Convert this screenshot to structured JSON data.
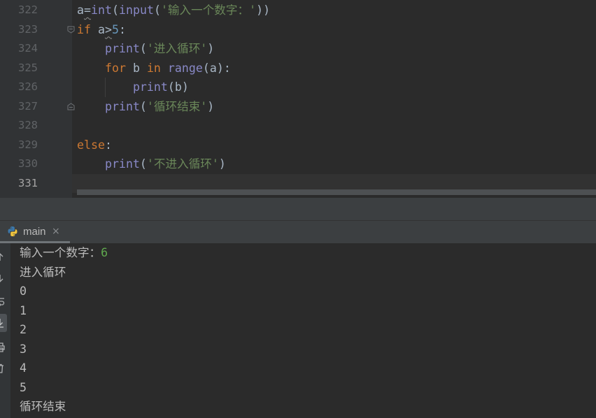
{
  "theme": {
    "editor_bg": "#2b2b2b",
    "gutter_bg": "#313335",
    "current_line_bg": "#323232",
    "line_number": "#606366",
    "current_line_number": "#a4a3a3",
    "code_text": "#a9b7c6",
    "panel_bg": "#3c3f41",
    "console_text": "#bbbbbb",
    "user_input": "#5fa84e"
  },
  "editor": {
    "lines": [
      {
        "number": "322",
        "tokens": [
          {
            "text": "a"
          },
          {
            "text": "=",
            "warn": true
          },
          {
            "text": "int",
            "color": "#8888c6"
          },
          {
            "text": "("
          },
          {
            "text": "input",
            "color": "#8888c6"
          },
          {
            "text": "("
          },
          {
            "text": "'输入一个数字：'",
            "color": "#6a8759"
          },
          {
            "text": "))"
          }
        ]
      },
      {
        "number": "323",
        "fold": "fold-start-icon",
        "tokens": [
          {
            "text": "if",
            "color": "#cc7832"
          },
          {
            "text": " a"
          },
          {
            "text": ">",
            "warn": true
          },
          {
            "text": "5",
            "color": "#6897bb"
          },
          {
            "text": ":"
          }
        ]
      },
      {
        "number": "324",
        "tokens": [
          {
            "text": "    "
          },
          {
            "text": "print",
            "color": "#8888c6"
          },
          {
            "text": "("
          },
          {
            "text": "'进入循环'",
            "color": "#6a8759"
          },
          {
            "text": ")"
          }
        ]
      },
      {
        "number": "325",
        "tokens": [
          {
            "text": "    "
          },
          {
            "text": "for",
            "color": "#cc7832"
          },
          {
            "text": " b "
          },
          {
            "text": "in",
            "color": "#cc7832"
          },
          {
            "text": " "
          },
          {
            "text": "range",
            "color": "#8888c6"
          },
          {
            "text": "(a):"
          }
        ]
      },
      {
        "number": "326",
        "tokens": [
          {
            "text": "        "
          },
          {
            "text": "print",
            "color": "#8888c6"
          },
          {
            "text": "(b)"
          }
        ]
      },
      {
        "number": "327",
        "fold": "fold-end-icon",
        "tokens": [
          {
            "text": "    "
          },
          {
            "text": "print",
            "color": "#8888c6"
          },
          {
            "text": "("
          },
          {
            "text": "'循环结束'",
            "color": "#6a8759"
          },
          {
            "text": ")"
          }
        ]
      },
      {
        "number": "328",
        "tokens": []
      },
      {
        "number": "329",
        "tokens": [
          {
            "text": "else",
            "color": "#cc7832"
          },
          {
            "text": ":"
          }
        ]
      },
      {
        "number": "330",
        "tokens": [
          {
            "text": "    "
          },
          {
            "text": "print",
            "color": "#8888c6"
          },
          {
            "text": "("
          },
          {
            "text": "'不进入循环'",
            "color": "#6a8759"
          },
          {
            "text": ")"
          }
        ]
      },
      {
        "number": "331",
        "current": true,
        "tokens": []
      }
    ]
  },
  "run_panel": {
    "tab": {
      "icon": "python-icon",
      "label": "main",
      "close_icon": "close-icon",
      "close_glyph": "×"
    },
    "toolbar_icons": [
      "up-stack-icon",
      "down-stack-icon",
      "soft-wrap-icon",
      "scroll-to-end-icon",
      "print-icon",
      "clear-all-icon"
    ],
    "console": {
      "prompt": "输入一个数字：",
      "user_input": "6",
      "output": [
        "进入循环",
        "0",
        "1",
        "2",
        "3",
        "4",
        "5",
        "循环结束"
      ]
    }
  }
}
